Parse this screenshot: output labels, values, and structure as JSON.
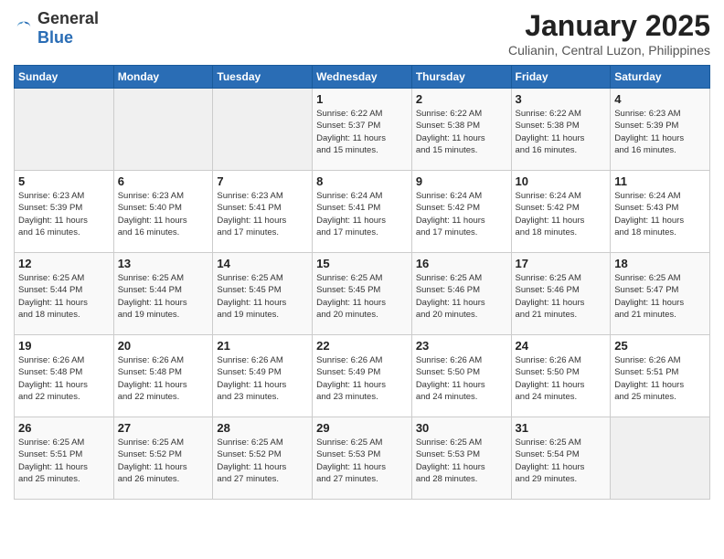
{
  "header": {
    "logo_general": "General",
    "logo_blue": "Blue",
    "month_title": "January 2025",
    "subtitle": "Culianin, Central Luzon, Philippines"
  },
  "weekdays": [
    "Sunday",
    "Monday",
    "Tuesday",
    "Wednesday",
    "Thursday",
    "Friday",
    "Saturday"
  ],
  "weeks": [
    [
      {
        "day": "",
        "info": ""
      },
      {
        "day": "",
        "info": ""
      },
      {
        "day": "",
        "info": ""
      },
      {
        "day": "1",
        "info": "Sunrise: 6:22 AM\nSunset: 5:37 PM\nDaylight: 11 hours\nand 15 minutes."
      },
      {
        "day": "2",
        "info": "Sunrise: 6:22 AM\nSunset: 5:38 PM\nDaylight: 11 hours\nand 15 minutes."
      },
      {
        "day": "3",
        "info": "Sunrise: 6:22 AM\nSunset: 5:38 PM\nDaylight: 11 hours\nand 16 minutes."
      },
      {
        "day": "4",
        "info": "Sunrise: 6:23 AM\nSunset: 5:39 PM\nDaylight: 11 hours\nand 16 minutes."
      }
    ],
    [
      {
        "day": "5",
        "info": "Sunrise: 6:23 AM\nSunset: 5:39 PM\nDaylight: 11 hours\nand 16 minutes."
      },
      {
        "day": "6",
        "info": "Sunrise: 6:23 AM\nSunset: 5:40 PM\nDaylight: 11 hours\nand 16 minutes."
      },
      {
        "day": "7",
        "info": "Sunrise: 6:23 AM\nSunset: 5:41 PM\nDaylight: 11 hours\nand 17 minutes."
      },
      {
        "day": "8",
        "info": "Sunrise: 6:24 AM\nSunset: 5:41 PM\nDaylight: 11 hours\nand 17 minutes."
      },
      {
        "day": "9",
        "info": "Sunrise: 6:24 AM\nSunset: 5:42 PM\nDaylight: 11 hours\nand 17 minutes."
      },
      {
        "day": "10",
        "info": "Sunrise: 6:24 AM\nSunset: 5:42 PM\nDaylight: 11 hours\nand 18 minutes."
      },
      {
        "day": "11",
        "info": "Sunrise: 6:24 AM\nSunset: 5:43 PM\nDaylight: 11 hours\nand 18 minutes."
      }
    ],
    [
      {
        "day": "12",
        "info": "Sunrise: 6:25 AM\nSunset: 5:44 PM\nDaylight: 11 hours\nand 18 minutes."
      },
      {
        "day": "13",
        "info": "Sunrise: 6:25 AM\nSunset: 5:44 PM\nDaylight: 11 hours\nand 19 minutes."
      },
      {
        "day": "14",
        "info": "Sunrise: 6:25 AM\nSunset: 5:45 PM\nDaylight: 11 hours\nand 19 minutes."
      },
      {
        "day": "15",
        "info": "Sunrise: 6:25 AM\nSunset: 5:45 PM\nDaylight: 11 hours\nand 20 minutes."
      },
      {
        "day": "16",
        "info": "Sunrise: 6:25 AM\nSunset: 5:46 PM\nDaylight: 11 hours\nand 20 minutes."
      },
      {
        "day": "17",
        "info": "Sunrise: 6:25 AM\nSunset: 5:46 PM\nDaylight: 11 hours\nand 21 minutes."
      },
      {
        "day": "18",
        "info": "Sunrise: 6:25 AM\nSunset: 5:47 PM\nDaylight: 11 hours\nand 21 minutes."
      }
    ],
    [
      {
        "day": "19",
        "info": "Sunrise: 6:26 AM\nSunset: 5:48 PM\nDaylight: 11 hours\nand 22 minutes."
      },
      {
        "day": "20",
        "info": "Sunrise: 6:26 AM\nSunset: 5:48 PM\nDaylight: 11 hours\nand 22 minutes."
      },
      {
        "day": "21",
        "info": "Sunrise: 6:26 AM\nSunset: 5:49 PM\nDaylight: 11 hours\nand 23 minutes."
      },
      {
        "day": "22",
        "info": "Sunrise: 6:26 AM\nSunset: 5:49 PM\nDaylight: 11 hours\nand 23 minutes."
      },
      {
        "day": "23",
        "info": "Sunrise: 6:26 AM\nSunset: 5:50 PM\nDaylight: 11 hours\nand 24 minutes."
      },
      {
        "day": "24",
        "info": "Sunrise: 6:26 AM\nSunset: 5:50 PM\nDaylight: 11 hours\nand 24 minutes."
      },
      {
        "day": "25",
        "info": "Sunrise: 6:26 AM\nSunset: 5:51 PM\nDaylight: 11 hours\nand 25 minutes."
      }
    ],
    [
      {
        "day": "26",
        "info": "Sunrise: 6:25 AM\nSunset: 5:51 PM\nDaylight: 11 hours\nand 25 minutes."
      },
      {
        "day": "27",
        "info": "Sunrise: 6:25 AM\nSunset: 5:52 PM\nDaylight: 11 hours\nand 26 minutes."
      },
      {
        "day": "28",
        "info": "Sunrise: 6:25 AM\nSunset: 5:52 PM\nDaylight: 11 hours\nand 27 minutes."
      },
      {
        "day": "29",
        "info": "Sunrise: 6:25 AM\nSunset: 5:53 PM\nDaylight: 11 hours\nand 27 minutes."
      },
      {
        "day": "30",
        "info": "Sunrise: 6:25 AM\nSunset: 5:53 PM\nDaylight: 11 hours\nand 28 minutes."
      },
      {
        "day": "31",
        "info": "Sunrise: 6:25 AM\nSunset: 5:54 PM\nDaylight: 11 hours\nand 29 minutes."
      },
      {
        "day": "",
        "info": ""
      }
    ]
  ]
}
